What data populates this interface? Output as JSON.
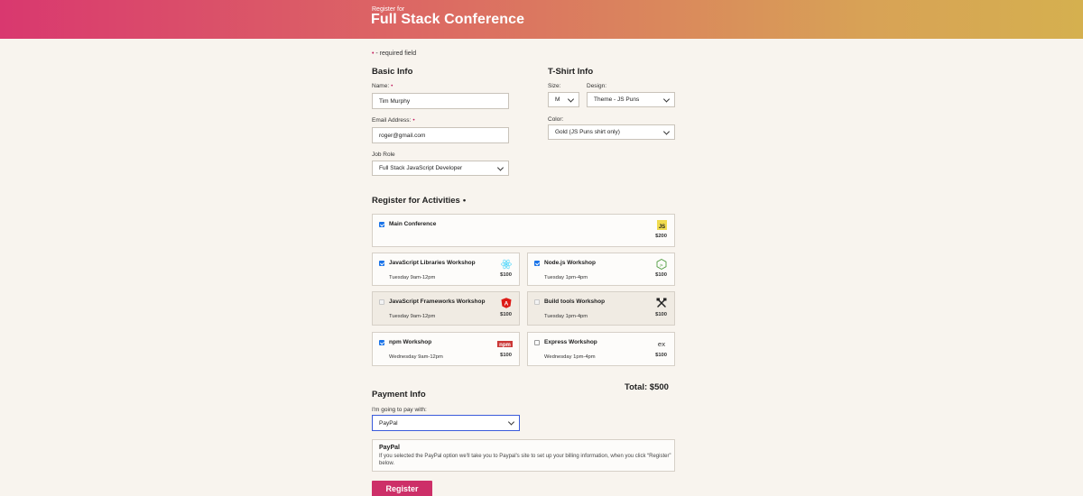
{
  "header": {
    "pre_title": "Register for",
    "title": "Full Stack Conference"
  },
  "required_note": "- required field",
  "basic_info": {
    "heading": "Basic Info",
    "name_label": "Name:",
    "name_value": "Tim Murphy",
    "email_label": "Email Address:",
    "email_value": "roger@gmail.com",
    "job_label": "Job Role",
    "job_value": "Full Stack JavaScript Developer"
  },
  "tshirt": {
    "heading": "T-Shirt Info",
    "size_label": "Size:",
    "size_value": "M",
    "design_label": "Design:",
    "design_value": "Theme - JS Puns",
    "color_label": "Color:",
    "color_value": "Gold (JS Puns shirt only)"
  },
  "activities": {
    "heading": "Register for Activities",
    "items": [
      {
        "name": "Main Conference",
        "time": "",
        "cost": "$200",
        "checked": true,
        "disabled": false,
        "icon": "js-icon"
      },
      {
        "name": "JavaScript Libraries Workshop",
        "time": "Tuesday 9am-12pm",
        "cost": "$100",
        "checked": true,
        "disabled": false,
        "icon": "react-icon"
      },
      {
        "name": "Node.js Workshop",
        "time": "Tuesday 1pm-4pm",
        "cost": "$100",
        "checked": true,
        "disabled": false,
        "icon": "nodejs-icon"
      },
      {
        "name": "JavaScript Frameworks Workshop",
        "time": "Tuesday 9am-12pm",
        "cost": "$100",
        "checked": false,
        "disabled": true,
        "icon": "angular-icon"
      },
      {
        "name": "Build tools Workshop",
        "time": "Tuesday 1pm-4pm",
        "cost": "$100",
        "checked": false,
        "disabled": true,
        "icon": "tools-icon"
      },
      {
        "name": "npm Workshop",
        "time": "Wednesday 9am-12pm",
        "cost": "$100",
        "checked": true,
        "disabled": false,
        "icon": "npm-icon"
      },
      {
        "name": "Express Workshop",
        "time": "Wednesday 1pm-4pm",
        "cost": "$100",
        "checked": false,
        "disabled": false,
        "icon": "express-icon"
      }
    ],
    "total": "Total: $500"
  },
  "payment": {
    "heading": "Payment Info",
    "pay_label": "I'm going to pay with:",
    "pay_value": "PayPal",
    "paypal_title": "PayPal",
    "paypal_desc": "If you selected the PayPal option we'll take you to Paypal's site to set up your billing information, when you click “Register” below."
  },
  "register_label": "Register",
  "colors": {
    "accent": "#cd2f68",
    "header_start": "#d9386f",
    "header_end": "#d5b04f",
    "checkbox": "#1a73e8"
  }
}
